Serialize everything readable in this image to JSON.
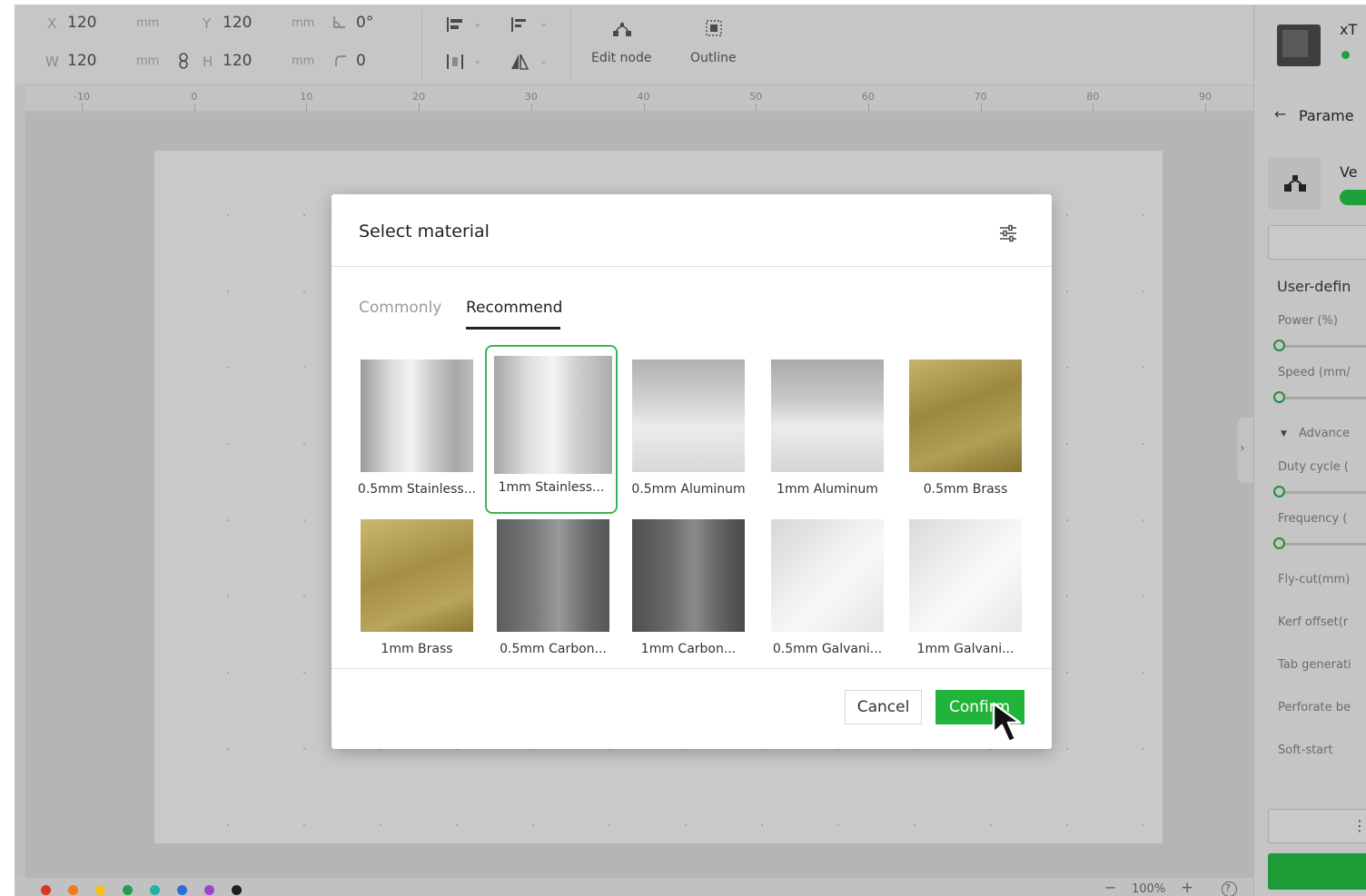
{
  "toolbar": {
    "x_label": "X",
    "x_value": "120",
    "x_unit": "mm",
    "y_label": "Y",
    "y_value": "120",
    "y_unit": "mm",
    "w_label": "W",
    "w_value": "120",
    "w_unit": "mm",
    "h_label": "H",
    "h_value": "120",
    "h_unit": "mm",
    "rotation_value": "0°",
    "corner_value": "0",
    "edit_node_label": "Edit node",
    "outline_label": "Outline"
  },
  "ruler": {
    "ticks": [
      "-10",
      "0",
      "10",
      "20",
      "30",
      "40",
      "50",
      "60",
      "70",
      "80",
      "90"
    ]
  },
  "right_panel": {
    "device_name": "xT",
    "back_label": "Parame",
    "section_label": "Ve",
    "user_defined_label": "User-defin",
    "params": {
      "power": "Power (%)",
      "speed": "Speed (mm/",
      "advanced": "Advance",
      "duty_cycle": "Duty cycle (",
      "frequency": "Frequency (",
      "fly_cut": "Fly-cut(mm)",
      "kerf_offset": "Kerf offset(r",
      "tab_generation": "Tab generati",
      "perforate": "Perforate be",
      "soft_start": "Soft-start"
    }
  },
  "modal": {
    "title": "Select material",
    "tabs": [
      "Commonly",
      "Recommend"
    ],
    "active_tab": "Recommend",
    "materials": [
      {
        "name": "0.5mm Stainless..."
      },
      {
        "name": "1mm Stainless..."
      },
      {
        "name": "0.5mm Aluminum"
      },
      {
        "name": "1mm Aluminum"
      },
      {
        "name": "0.5mm Brass"
      },
      {
        "name": "1mm Brass"
      },
      {
        "name": "0.5mm Carbon..."
      },
      {
        "name": "1mm Carbon..."
      },
      {
        "name": "0.5mm Galvani..."
      },
      {
        "name": "1mm Galvani..."
      }
    ],
    "selected_material": "1mm Stainless...",
    "cancel_label": "Cancel",
    "confirm_label": "Confirm"
  },
  "bottom_bar": {
    "zoom_value": "100%",
    "zoom_out": "−",
    "zoom_in": "+",
    "help": "?",
    "layer_colors": [
      "#d9352a",
      "#ef7d1a",
      "#f2c21d",
      "#1f9e52",
      "#22b3a6",
      "#2b6fd6",
      "#9a46d0",
      "#1e1e1e"
    ]
  },
  "colors": {
    "accent": "#22b43a",
    "selected_border": "#3bb552"
  }
}
